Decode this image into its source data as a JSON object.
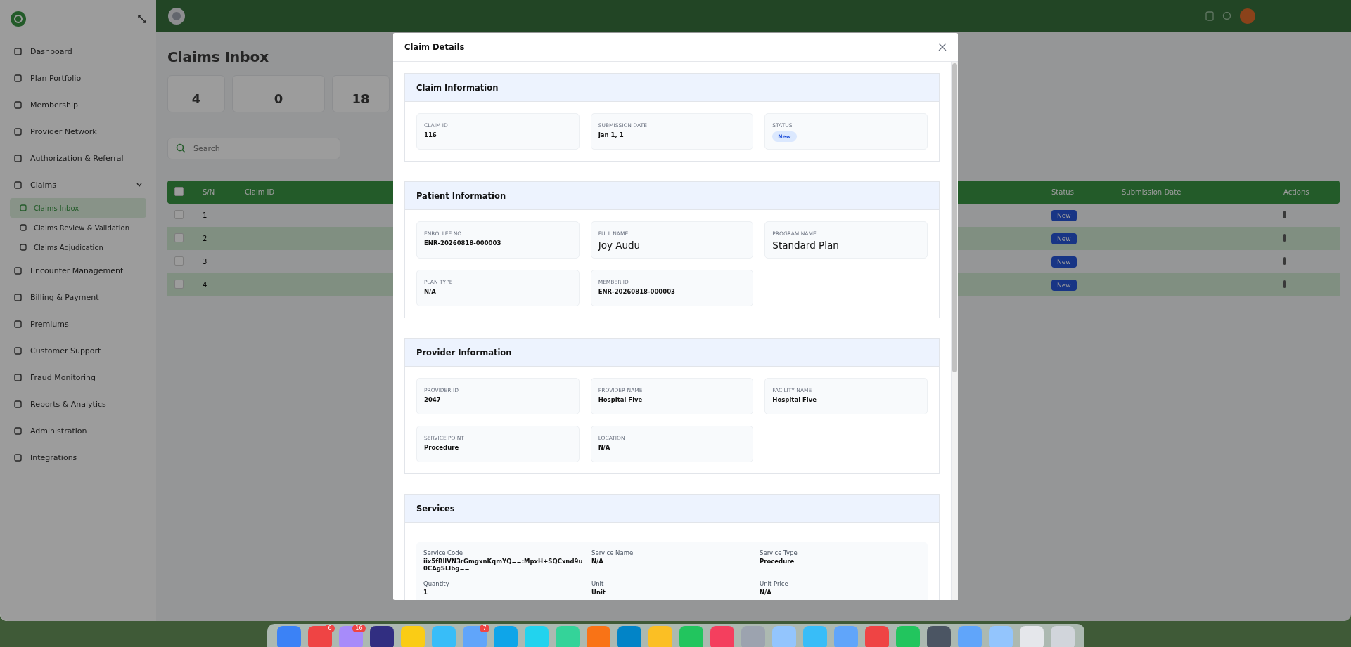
{
  "sidebar": {
    "items": [
      {
        "label": "Dashboard",
        "selected": false
      },
      {
        "label": "Plan Portfolio",
        "selected": false
      },
      {
        "label": "Membership",
        "selected": false
      },
      {
        "label": "Provider Network",
        "selected": false
      },
      {
        "label": "Authorization & Referral",
        "selected": false
      },
      {
        "label": "Claims",
        "selected": false,
        "children": [
          {
            "label": "Claims Inbox",
            "selected": true
          },
          {
            "label": "Claims Review & Validation",
            "selected": false
          },
          {
            "label": "Claims Adjudication",
            "selected": false
          }
        ]
      },
      {
        "label": "Encounter Management",
        "selected": false
      },
      {
        "label": "Billing & Payment",
        "selected": false
      },
      {
        "label": "Premiums",
        "selected": false
      },
      {
        "label": "Customer Support",
        "selected": false
      },
      {
        "label": "Fraud Monitoring",
        "selected": false
      },
      {
        "label": "Reports & Analytics",
        "selected": false
      },
      {
        "label": "Administration",
        "selected": false
      },
      {
        "label": "Integrations",
        "selected": false
      }
    ]
  },
  "page": {
    "title": "Claims Inbox",
    "stats": [
      {
        "value": "4"
      },
      {
        "value": "0"
      },
      {
        "value": "18"
      }
    ],
    "search": {
      "placeholder": "Search"
    },
    "table": {
      "columns": [
        "S/N",
        "Claim ID",
        "Status",
        "Submission Date",
        "Actions"
      ],
      "all_checked": false,
      "rows": [
        {
          "sn": "1",
          "status": "New",
          "checked": false
        },
        {
          "sn": "2",
          "status": "New",
          "checked": false
        },
        {
          "sn": "3",
          "status": "New",
          "checked": false
        },
        {
          "sn": "4",
          "status": "New",
          "checked": false
        }
      ]
    }
  },
  "modal": {
    "title": "Claim Details",
    "sections": [
      {
        "kind": "fields",
        "title": "Claim Information",
        "fields": [
          {
            "label": "CLAIM ID",
            "value": "116",
            "kind": "text"
          },
          {
            "label": "SUBMISSION DATE",
            "value": "Jan 1, 1",
            "kind": "text"
          },
          {
            "label": "STATUS",
            "value": "New",
            "kind": "badge"
          }
        ]
      },
      {
        "kind": "fields",
        "title": "Patient Information",
        "fields": [
          {
            "label": "ENROLLEE NO",
            "value": "ENR-20260818-000003",
            "kind": "text"
          },
          {
            "label": "FULL NAME",
            "value": "Joy Audu",
            "kind": "large"
          },
          {
            "label": "PROGRAM NAME",
            "value": "Standard Plan",
            "kind": "large"
          },
          {
            "label": "PLAN TYPE",
            "value": "N/A",
            "kind": "text"
          },
          {
            "label": "MEMBER ID",
            "value": "ENR-20260818-000003",
            "kind": "text"
          }
        ]
      },
      {
        "kind": "fields",
        "title": "Provider Information",
        "fields": [
          {
            "label": "PROVIDER ID",
            "value": "2047",
            "kind": "text"
          },
          {
            "label": "PROVIDER NAME",
            "value": "Hospital Five",
            "kind": "text"
          },
          {
            "label": "FACILITY NAME",
            "value": "Hospital Five",
            "kind": "text"
          },
          {
            "label": "SERVICE POINT",
            "value": "Procedure",
            "kind": "text"
          },
          {
            "label": "LOCATION",
            "value": "N/A",
            "kind": "text"
          }
        ]
      },
      {
        "kind": "services",
        "title": "Services",
        "services": [
          {
            "fields": [
              {
                "label": "Service Code",
                "value": "iix5fBllVN3rGmgxnKqmYQ==:MpxH+SQCxnd9u0CAgSLlbg=="
              },
              {
                "label": "Service Name",
                "value": "N/A"
              },
              {
                "label": "Service Type",
                "value": "Procedure"
              },
              {
                "label": "Quantity",
                "value": "1"
              },
              {
                "label": "Unit",
                "value": "Unit"
              },
              {
                "label": "Unit Price",
                "value": "N/A"
              }
            ]
          }
        ]
      }
    ]
  },
  "dock": {
    "badges": [
      "6",
      "16",
      "7"
    ]
  }
}
